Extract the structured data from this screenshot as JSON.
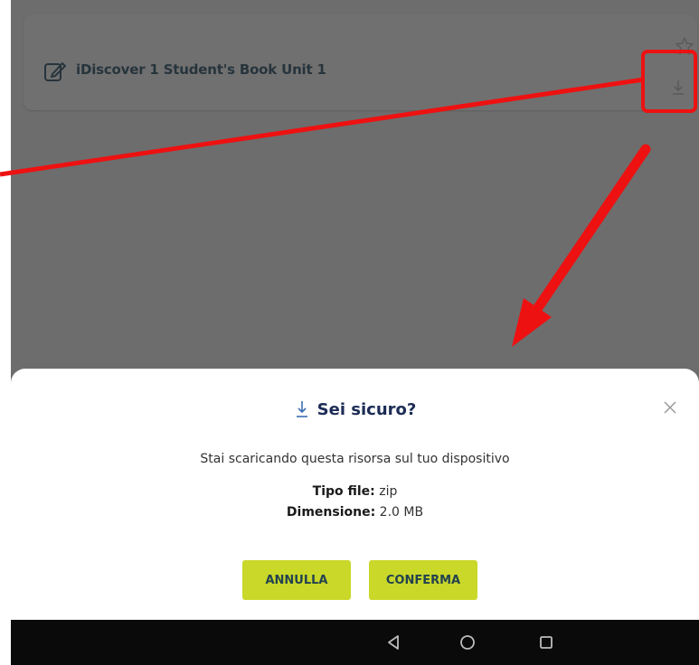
{
  "resource_card": {
    "title": "iDiscover 1 Student's Book Unit 1",
    "icons": {
      "edit": "edit-note-icon",
      "favorite": "star-outline-icon",
      "download": "download-icon"
    }
  },
  "dialog": {
    "title": "Sei sicuro?",
    "message": "Stai scaricando questa risorsa sul tuo dispositivo",
    "file_type_label": "Tipo file:",
    "file_type_value": "zip",
    "size_label": "Dimensione:",
    "size_value": "2.0 MB",
    "cancel_label": "ANNULLA",
    "confirm_label": "CONFERMA",
    "icons": {
      "title": "download-icon",
      "close": "close-icon"
    }
  },
  "navbar": {
    "icons": [
      "back-triangle-icon",
      "home-circle-icon",
      "recent-apps-square-icon"
    ]
  },
  "colors": {
    "dim_overlay": "#6d6d6d",
    "annotation_red": "#ee1111",
    "button_green": "#c9d829",
    "title_blue": "#1c2c55"
  }
}
